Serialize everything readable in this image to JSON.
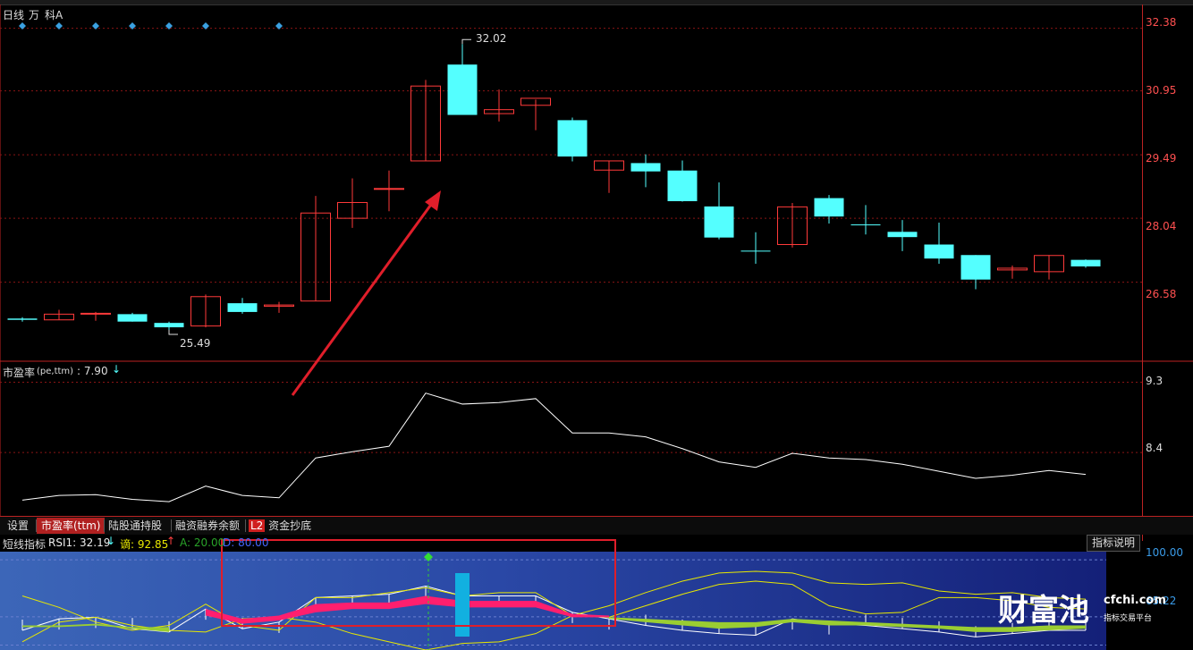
{
  "header": {
    "period": "日线",
    "tag_wan": "万",
    "stock_name": "科A"
  },
  "price_axis": [
    "32.38",
    "30.95",
    "29.49",
    "28.04",
    "26.58"
  ],
  "price_labels": {
    "high": "32.02",
    "low": "25.49"
  },
  "pe_panel": {
    "title": "市盈率",
    "params": "(pe,ttm)",
    "value": ": 7.90",
    "axis": [
      "9.3",
      "8.4"
    ]
  },
  "tabs": [
    {
      "label": "设置",
      "active": false
    },
    {
      "label": "市盈率(ttm)",
      "active": true
    },
    {
      "label": "陆股通持股",
      "active": false
    },
    {
      "label": "融资融券余额",
      "active": false
    },
    {
      "label": "资金抄底",
      "active": false,
      "badge": "L2"
    }
  ],
  "rsi_panel": {
    "title": "短线指标",
    "rsi1": "RSI1: 32.19",
    "dot": "谪: 92.85",
    "a": "A: 20.00",
    "d": "D: 80.00",
    "axis": [
      "100.00",
      "65.22"
    ],
    "help_label": "指标说明"
  },
  "watermark": {
    "brand": "财富池",
    "site": "cfchi.com",
    "slogan": "指标交易平台"
  },
  "colors": {
    "up": "#ff3a3a",
    "down": "#54ffff",
    "grid": "#8a1414",
    "axis_text": "#ff5050",
    "pe_line": "#ffffff",
    "rsi_pink": "#ff1f6e",
    "rsi_green": "#9acd32",
    "yellow": "#e8e800",
    "diamond": "#3aa0e0"
  },
  "chart_data": [
    {
      "type": "candlestick",
      "title": "",
      "ylim": [
        25.0,
        32.8
      ],
      "candles": [
        {
          "o": 25.75,
          "h": 25.78,
          "l": 25.68,
          "c": 25.72
        },
        {
          "o": 25.72,
          "h": 25.95,
          "l": 25.72,
          "c": 25.85
        },
        {
          "o": 25.85,
          "h": 25.9,
          "l": 25.7,
          "c": 25.87
        },
        {
          "o": 25.85,
          "h": 25.88,
          "l": 25.68,
          "c": 25.68
        },
        {
          "o": 25.65,
          "h": 25.68,
          "l": 25.49,
          "c": 25.55
        },
        {
          "o": 25.58,
          "h": 26.3,
          "l": 25.55,
          "c": 26.25
        },
        {
          "o": 26.1,
          "h": 26.22,
          "l": 25.86,
          "c": 25.9
        },
        {
          "o": 26.03,
          "h": 26.13,
          "l": 25.88,
          "c": 26.06
        },
        {
          "o": 26.15,
          "h": 28.55,
          "l": 26.15,
          "c": 28.16
        },
        {
          "o": 28.04,
          "h": 28.95,
          "l": 27.82,
          "c": 28.4
        },
        {
          "o": 28.7,
          "h": 29.13,
          "l": 28.2,
          "c": 28.72
        },
        {
          "o": 29.35,
          "h": 31.2,
          "l": 29.35,
          "c": 31.06
        },
        {
          "o": 31.55,
          "h": 32.02,
          "l": 30.48,
          "c": 30.4
        },
        {
          "o": 30.43,
          "h": 30.98,
          "l": 30.25,
          "c": 30.52
        },
        {
          "o": 30.62,
          "h": 30.75,
          "l": 30.05,
          "c": 30.78
        },
        {
          "o": 30.28,
          "h": 30.34,
          "l": 29.34,
          "c": 29.45
        },
        {
          "o": 29.14,
          "h": 29.35,
          "l": 28.62,
          "c": 29.35
        },
        {
          "o": 29.3,
          "h": 29.5,
          "l": 28.75,
          "c": 29.11
        },
        {
          "o": 29.13,
          "h": 29.36,
          "l": 28.42,
          "c": 28.43
        },
        {
          "o": 28.31,
          "h": 28.86,
          "l": 27.56,
          "c": 27.6
        },
        {
          "o": 27.3,
          "h": 27.72,
          "l": 27.0,
          "c": 27.28
        },
        {
          "o": 27.44,
          "h": 28.39,
          "l": 27.37,
          "c": 28.3
        },
        {
          "o": 28.5,
          "h": 28.57,
          "l": 27.92,
          "c": 28.08
        },
        {
          "o": 27.9,
          "h": 28.34,
          "l": 27.67,
          "c": 27.88
        },
        {
          "o": 27.73,
          "h": 28.0,
          "l": 27.29,
          "c": 27.61
        },
        {
          "o": 27.44,
          "h": 27.94,
          "l": 27.0,
          "c": 27.12
        },
        {
          "o": 27.2,
          "h": 27.2,
          "l": 26.42,
          "c": 26.64
        },
        {
          "o": 26.86,
          "h": 26.96,
          "l": 26.66,
          "c": 26.9
        },
        {
          "o": 26.82,
          "h": 27.2,
          "l": 26.64,
          "c": 27.19
        },
        {
          "o": 27.09,
          "h": 27.1,
          "l": 26.91,
          "c": 26.94
        }
      ]
    },
    {
      "type": "line",
      "title": "市盈率(pe,ttm)",
      "ylim": [
        7.6,
        9.5
      ],
      "values": [
        7.79,
        7.85,
        7.86,
        7.8,
        7.77,
        7.97,
        7.85,
        7.82,
        8.33,
        8.41,
        8.48,
        9.16,
        9.02,
        9.04,
        9.09,
        8.65,
        8.65,
        8.6,
        8.45,
        8.28,
        8.21,
        8.39,
        8.33,
        8.31,
        8.25,
        8.16,
        8.07,
        8.11,
        8.17,
        8.12
      ]
    },
    {
      "type": "line",
      "title": "短线指标",
      "ylim": [
        45,
        105
      ],
      "series": [
        {
          "values": [
            57,
            64,
            65,
            58,
            56,
            70,
            58,
            62,
            77,
            78,
            79,
            84,
            78,
            78,
            78,
            68,
            64,
            60,
            57,
            55,
            54,
            64,
            61,
            60,
            58,
            56,
            53,
            55,
            57,
            57
          ]
        },
        {
          "values": [
            78,
            71,
            62,
            57,
            60,
            73,
            60,
            57,
            77,
            77,
            80,
            83,
            78,
            80,
            80,
            66,
            65,
            72,
            79,
            85,
            87,
            85,
            72,
            67,
            68,
            77,
            77,
            75,
            71,
            70
          ]
        },
        {
          "values": [
            50,
            62,
            65,
            60,
            57,
            56,
            64,
            65,
            62,
            55,
            50,
            45,
            49,
            50,
            55,
            66,
            72,
            80,
            87,
            92,
            93,
            92,
            86,
            85,
            86,
            81,
            79,
            80,
            77,
            76
          ]
        }
      ]
    }
  ]
}
